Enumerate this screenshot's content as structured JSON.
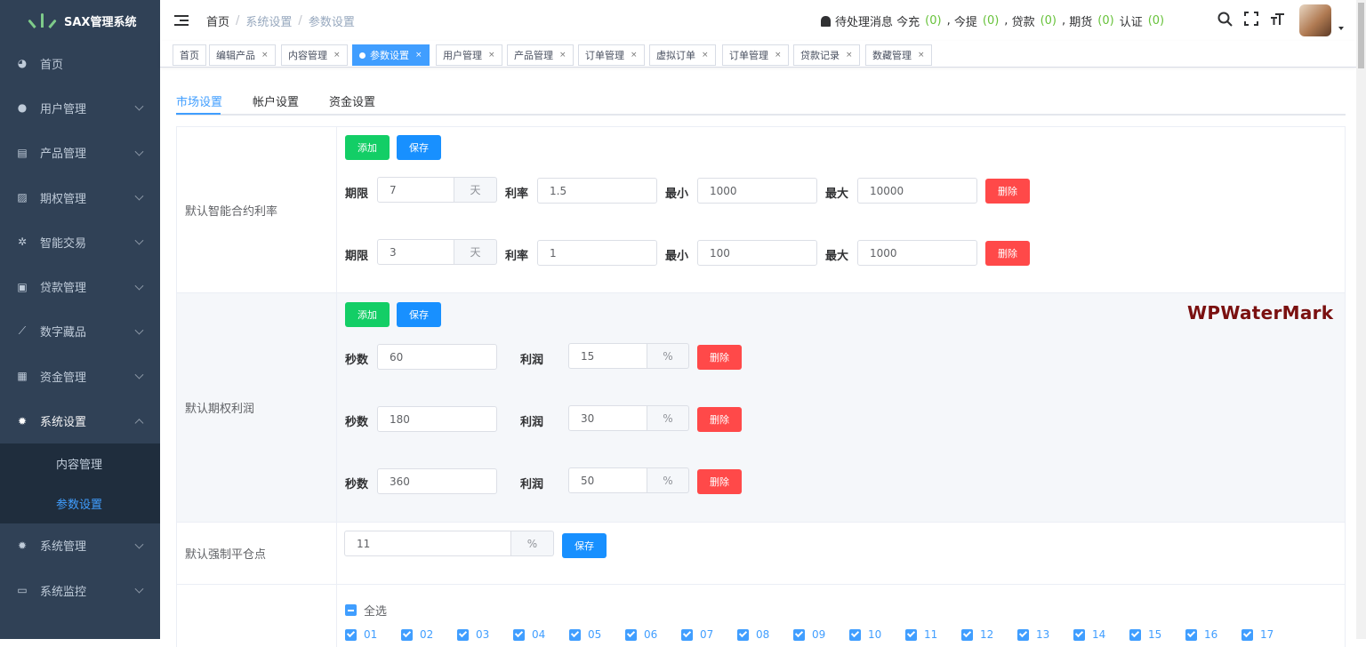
{
  "app": {
    "title": "SAX管理系统"
  },
  "sidebar": {
    "items": [
      {
        "label": "首页",
        "icon": "dashboard-icon",
        "chevron": false
      },
      {
        "label": "用户管理",
        "icon": "user-icon",
        "chevron": true
      },
      {
        "label": "产品管理",
        "icon": "document-icon",
        "chevron": true
      },
      {
        "label": "期权管理",
        "icon": "chart-icon",
        "chevron": true
      },
      {
        "label": "智能交易",
        "icon": "gear-icon",
        "chevron": true
      },
      {
        "label": "贷款管理",
        "icon": "money-icon",
        "chevron": true
      },
      {
        "label": "数字藏品",
        "icon": "link-icon",
        "chevron": true
      },
      {
        "label": "资金管理",
        "icon": "wallet-icon",
        "chevron": true
      },
      {
        "label": "系统设置",
        "icon": "settings-icon",
        "chevron": true,
        "open": true
      },
      {
        "label": "系统管理",
        "icon": "settings-icon",
        "chevron": true
      },
      {
        "label": "系统监控",
        "icon": "monitor-icon",
        "chevron": true
      }
    ],
    "submenu": [
      {
        "label": "内容管理",
        "active": false
      },
      {
        "label": "参数设置",
        "active": true
      }
    ]
  },
  "breadcrumb": {
    "home": "首页",
    "level1": "系统设置",
    "current": "参数设置"
  },
  "notice": {
    "pending": "待处理消息",
    "items": [
      {
        "label": "今充",
        "count": "(0)"
      },
      {
        "label": "今提",
        "count": "(0)"
      },
      {
        "label": "贷款",
        "count": "(0)"
      },
      {
        "label": "期货",
        "count": "(0)"
      },
      {
        "label": "认证",
        "count": "(0)"
      }
    ]
  },
  "tags": [
    {
      "label": "首页",
      "close": false
    },
    {
      "label": "编辑产品",
      "close": true
    },
    {
      "label": "内容管理",
      "close": true
    },
    {
      "label": "参数设置",
      "close": true,
      "active": true
    },
    {
      "label": "用户管理",
      "close": true
    },
    {
      "label": "产品管理",
      "close": true
    },
    {
      "label": "订单管理",
      "close": true
    },
    {
      "label": "虚拟订单",
      "close": true
    },
    {
      "label": "订单管理",
      "close": true
    },
    {
      "label": "贷款记录",
      "close": true
    },
    {
      "label": "数藏管理",
      "close": true
    }
  ],
  "tabs": [
    "市场设置",
    "帐户设置",
    "资金设置"
  ],
  "buttons": {
    "add": "添加",
    "save": "保存",
    "delete": "删除",
    "close": "×"
  },
  "contract_rate": {
    "label": "默认智能合约利率",
    "f_period": "期限",
    "f_rate": "利率",
    "f_min": "最小",
    "f_max": "最大",
    "unit": "天",
    "rows": [
      {
        "period": "7",
        "rate": "1.5",
        "min": "1000",
        "max": "10000"
      },
      {
        "period": "3",
        "rate": "1",
        "min": "100",
        "max": "1000"
      }
    ]
  },
  "option_profit": {
    "label": "默认期权利润",
    "f_seconds": "秒数",
    "f_profit": "利润",
    "unit": "%",
    "rows": [
      {
        "seconds": "60",
        "profit": "15"
      },
      {
        "seconds": "180",
        "profit": "30"
      },
      {
        "seconds": "360",
        "profit": "50"
      }
    ]
  },
  "liquidation": {
    "label": "默认强制平仓点",
    "value": "11",
    "unit": "%"
  },
  "checkboxes": {
    "select_all": "全选",
    "options": [
      "01",
      "02",
      "03",
      "04",
      "05",
      "06",
      "07",
      "08",
      "09",
      "10",
      "11",
      "12",
      "13",
      "14",
      "15",
      "16",
      "17"
    ]
  },
  "watermark": "WPWaterMark",
  "colors": {
    "sidebar": "#304156",
    "accent": "#409eff",
    "green": "#13ce66",
    "red": "#ff4949",
    "count": "#67c23a"
  }
}
